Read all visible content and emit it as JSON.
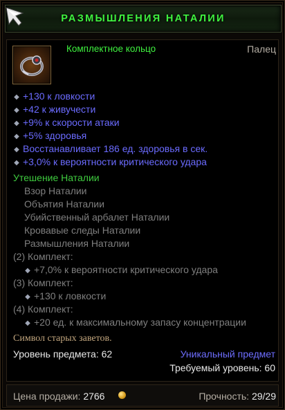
{
  "item": {
    "name": "РАЗМЫШЛЕНИЯ НАТАЛИИ",
    "type": "Комплектное кольцо",
    "slot": "Палец",
    "icon": "ring-icon"
  },
  "stats": [
    "+130 к ловкости",
    "+42 к живучести",
    "+9% к скорости атаки",
    "+5% здоровья",
    "Восстанавливает 186 ед. здоровья в сек.",
    "+3,0% к вероятности критического удара"
  ],
  "set": {
    "name": "Утешение Наталии",
    "pieces": [
      "Взор Наталии",
      "Объятия Наталии",
      "Убийственный арбалет Наталии",
      "Кровавые следы Наталии",
      "Размышления Наталии"
    ],
    "bonuses": [
      {
        "label": "(2) Комплект:",
        "effect": "+7,0% к вероятности критического удара"
      },
      {
        "label": "(3) Комплект:",
        "effect": "+130 к ловкости"
      },
      {
        "label": "(4) Комплект:",
        "effect": "+20 ед. к максимальному запасу концентрации"
      }
    ]
  },
  "flavor": "Символ старых заветов.",
  "rarity": "Уникальный предмет",
  "item_level_label": "Уровень предмета: 62",
  "required_level_label": "Требуемый уровень: 60",
  "sell_label": "Цена продажи:",
  "sell_value": "2766",
  "durability_label": "Прочность:",
  "durability_value": "29/29",
  "colors": {
    "title_green": "#3ff23f",
    "stat_blue": "#6b6bff",
    "set_green": "#3fcc3f",
    "inactive_grey": "#7f7f7f",
    "flavor_tan": "#c2a67e"
  }
}
